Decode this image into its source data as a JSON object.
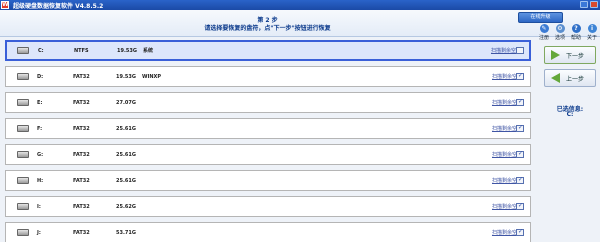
{
  "window": {
    "title": "超级硬盘数据恢复软件  V4.8.5.2",
    "app_icon_glyph": "W",
    "colors": {
      "titlebar": "#1f55b5",
      "selected_border": "#3a5fd8",
      "accent_text": "#0b3a8c"
    }
  },
  "header": {
    "step_label": "第 2 步",
    "instruction": "请选择要恢复的盘符，点\"下一步\"按钮进行恢复",
    "online_upgrade": "在线升级"
  },
  "toolbar": [
    {
      "label": "注册",
      "icon": "register-icon"
    },
    {
      "label": "选项",
      "icon": "options-icon"
    },
    {
      "label": "帮助",
      "icon": "help-icon"
    },
    {
      "label": "关于",
      "icon": "about-icon"
    }
  ],
  "drives": {
    "scan_label": "扫描剩余空间",
    "rows": [
      {
        "letter": "C:",
        "fs": "NTFS",
        "size": "19.53G",
        "name": "系统",
        "scan_checked": false,
        "selected": true
      },
      {
        "letter": "D:",
        "fs": "FAT32",
        "size": "19.53G",
        "name": "WINXP",
        "scan_checked": true,
        "selected": false
      },
      {
        "letter": "E:",
        "fs": "FAT32",
        "size": "27.07G",
        "name": "",
        "scan_checked": true,
        "selected": false
      },
      {
        "letter": "F:",
        "fs": "FAT32",
        "size": "25.61G",
        "name": "",
        "scan_checked": true,
        "selected": false
      },
      {
        "letter": "G:",
        "fs": "FAT32",
        "size": "25.61G",
        "name": "",
        "scan_checked": true,
        "selected": false
      },
      {
        "letter": "H:",
        "fs": "FAT32",
        "size": "25.61G",
        "name": "",
        "scan_checked": true,
        "selected": false
      },
      {
        "letter": "I:",
        "fs": "FAT32",
        "size": "25.62G",
        "name": "",
        "scan_checked": true,
        "selected": false
      },
      {
        "letter": "J:",
        "fs": "FAT32",
        "size": "53.71G",
        "name": "",
        "scan_checked": true,
        "selected": false
      }
    ]
  },
  "side": {
    "next_label": "下一步",
    "prev_label": "上一步",
    "selected_title": "已选信息:",
    "selected_value": "C:"
  }
}
